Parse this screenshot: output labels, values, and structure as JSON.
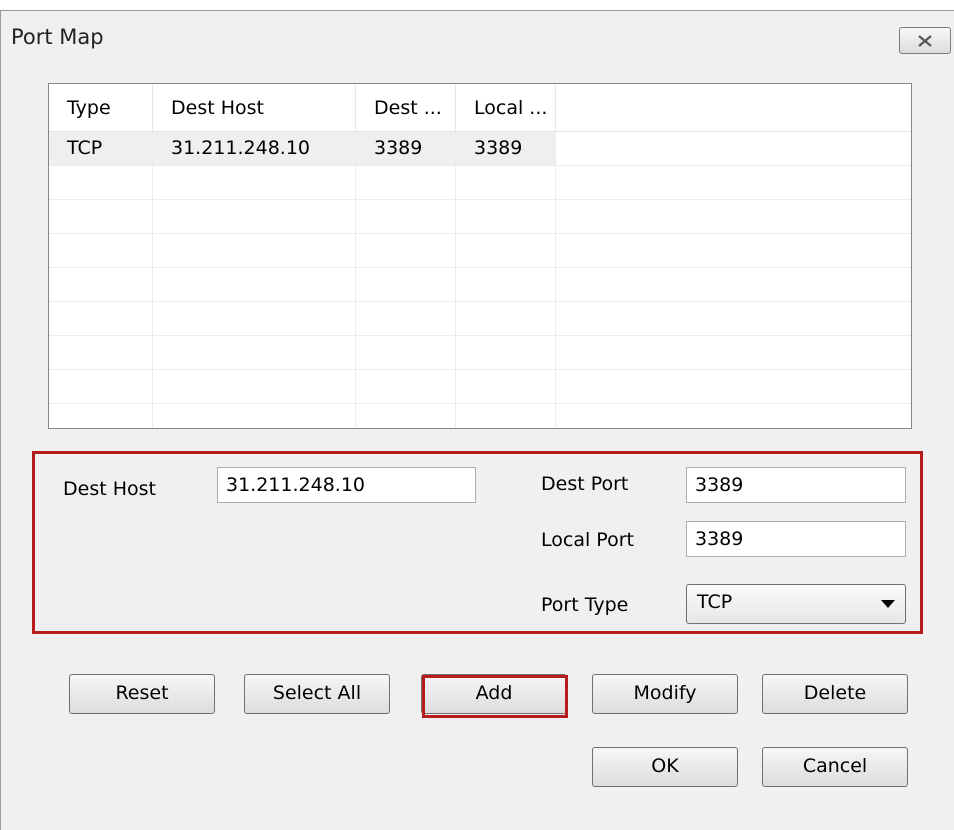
{
  "dialog": {
    "title": "Port Map",
    "close_label": "⌧"
  },
  "list": {
    "columns": [
      "Type",
      "Dest Host",
      "Dest ...",
      "Local ..."
    ],
    "rows": [
      [
        "TCP",
        "31.211.248.10",
        "3389",
        "3389"
      ]
    ]
  },
  "form": {
    "dest_host_label": "Dest Host",
    "dest_host_value": "31.211.248.10",
    "dest_port_label": "Dest Port",
    "dest_port_value": "3389",
    "local_port_label": "Local Port",
    "local_port_value": "3389",
    "port_type_label": "Port Type",
    "port_type_value": "TCP"
  },
  "buttons": {
    "reset": "Reset",
    "select_all": "Select All",
    "add": "Add",
    "modify": "Modify",
    "delete": "Delete",
    "ok": "OK",
    "cancel": "Cancel"
  },
  "colors": {
    "highlight": "#b71c1c",
    "dialog_bg": "#f0f0f0"
  }
}
